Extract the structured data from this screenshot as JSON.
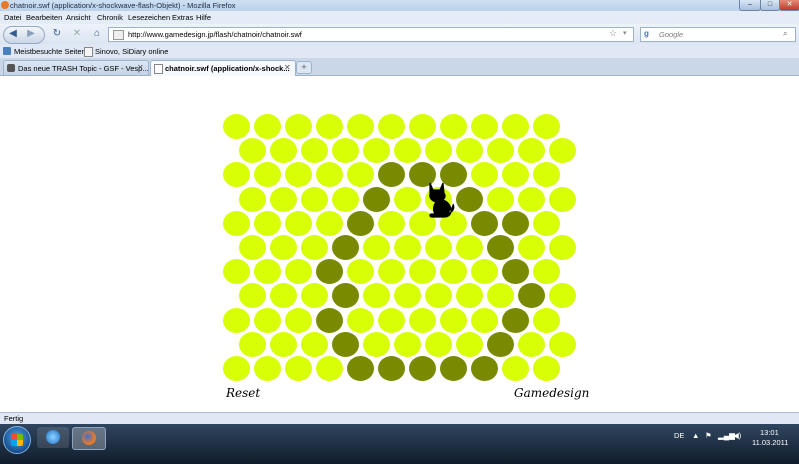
{
  "window": {
    "title": "chatnoir.swf (application/x-shockwave-flash-Objekt) - Mozilla Firefox",
    "controls": {
      "minimize": "–",
      "maximize": "□",
      "close": "✕"
    }
  },
  "menu": [
    "Datei",
    "Bearbeiten",
    "Ansicht",
    "Chronik",
    "Lesezeichen",
    "Extras",
    "Hilfe"
  ],
  "nav": {
    "url": "http://www.gamedesign.jp/flash/chatnoir/chatnoir.swf",
    "search_placeholder": "Google",
    "icons": [
      "back-icon",
      "forward-icon",
      "reload-icon",
      "stop-icon",
      "home-icon",
      "star-icon"
    ]
  },
  "bookmarks": [
    {
      "label": "Meistbesuchte Seiten",
      "icon": "bookmark-icon"
    },
    {
      "label": "Sinovo, SiDiary online",
      "icon": "page-icon"
    }
  ],
  "tabs": [
    {
      "label": "Das neue TRASH Topic - GSF - Vesp...",
      "active": false
    },
    {
      "label": "chatnoir.swf (application/x-shock...",
      "active": true
    }
  ],
  "game": {
    "reset_label": "Reset",
    "credit_label": "Gamedesign",
    "rows": 11,
    "cols": 11,
    "colors": {
      "open": "#d8ff06",
      "blocked": "#7a8a00",
      "cat": "#000000"
    },
    "blocked_cells": [
      [
        2,
        5
      ],
      [
        2,
        6
      ],
      [
        2,
        7
      ],
      [
        3,
        4
      ],
      [
        3,
        7
      ],
      [
        4,
        4
      ],
      [
        4,
        8
      ],
      [
        4,
        9
      ],
      [
        5,
        3
      ],
      [
        5,
        8
      ],
      [
        6,
        3
      ],
      [
        6,
        9
      ],
      [
        7,
        3
      ],
      [
        7,
        9
      ],
      [
        8,
        3
      ],
      [
        8,
        9
      ],
      [
        9,
        3
      ],
      [
        9,
        8
      ],
      [
        10,
        4
      ],
      [
        10,
        5
      ],
      [
        10,
        6
      ],
      [
        10,
        7
      ],
      [
        10,
        8
      ]
    ],
    "cat_cell": [
      3,
      6
    ]
  },
  "status": "Fertig",
  "taskbar": {
    "items": [
      {
        "name": "start-button"
      },
      {
        "name": "ie-icon"
      },
      {
        "name": "firefox-icon"
      }
    ],
    "lang": "DE",
    "time": "13:01",
    "date": "11.03.2011"
  }
}
